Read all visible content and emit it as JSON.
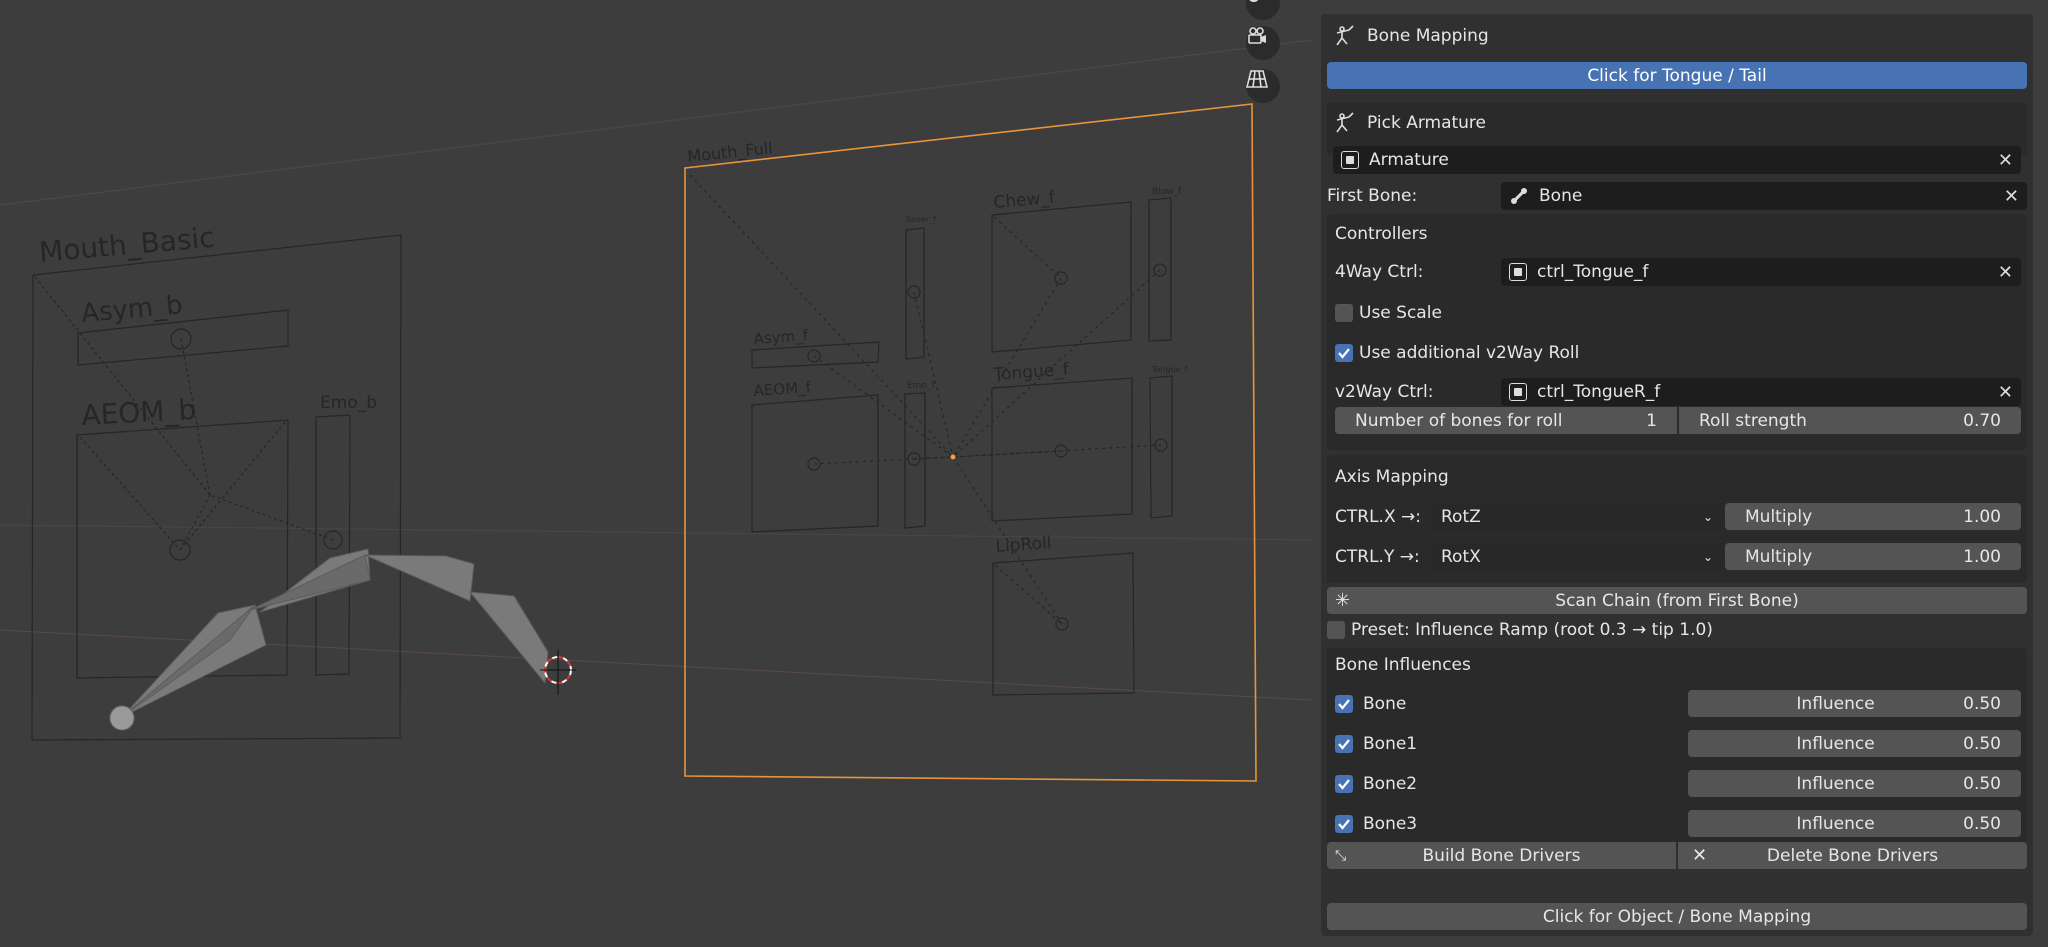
{
  "viewport": {
    "mouth_basic": {
      "title": "Mouth_Basic",
      "labels": [
        "Asym_b",
        "AEOM_b",
        "Emo_b"
      ]
    },
    "mouth_full": {
      "title": "Mouth_Full",
      "labels": [
        "Asym_f",
        "AEOM_f",
        "Sneer_f",
        "Emo_f",
        "Chew_f",
        "Blow_f",
        "Tongue_f",
        "Tongue_f",
        "LipRoll"
      ]
    },
    "tools": [
      "hand-icon",
      "camera-icon",
      "grid-icon"
    ]
  },
  "panel": {
    "header_title": "Bone Mapping",
    "tongue_button": "Click for Tongue / Tail",
    "pick_armature_label": "Pick Armature",
    "armature_value": "Armature",
    "first_bone_label": "First Bone:",
    "first_bone_value": "Bone",
    "controllers_label": "Controllers",
    "fourway_label": "4Way Ctrl:",
    "fourway_value": "ctrl_Tongue_f",
    "use_scale_label": "Use Scale",
    "use_scale_checked": false,
    "use_v2way_label": "Use additional v2Way Roll",
    "use_v2way_checked": true,
    "v2way_label": "v2Way Ctrl:",
    "v2way_value": "ctrl_TongueR_f",
    "num_bones_label": "Number of bones for roll",
    "num_bones_value": "1",
    "roll_strength_label": "Roll strength",
    "roll_strength_value": "0.70",
    "axis_mapping_label": "Axis Mapping",
    "axis_rows": [
      {
        "label": "CTRL.X →:",
        "select": "RotZ",
        "mult_label": "Multiply",
        "mult_value": "1.00"
      },
      {
        "label": "CTRL.Y →:",
        "select": "RotX",
        "mult_label": "Multiply",
        "mult_value": "1.00"
      }
    ],
    "scan_chain_button": "Scan Chain (from First Bone)",
    "preset_label": "Preset: Influence Ramp (root 0.3 → tip 1.0)",
    "bone_influences_label": "Bone Influences",
    "bones": [
      {
        "name": "Bone",
        "checked": true,
        "influence_label": "Influence",
        "influence_value": "0.50"
      },
      {
        "name": "Bone1",
        "checked": true,
        "influence_label": "Influence",
        "influence_value": "0.50"
      },
      {
        "name": "Bone2",
        "checked": true,
        "influence_label": "Influence",
        "influence_value": "0.50"
      },
      {
        "name": "Bone3",
        "checked": true,
        "influence_label": "Influence",
        "influence_value": "0.50"
      }
    ],
    "build_drivers_button": "Build Bone Drivers",
    "delete_drivers_button": "Delete Bone Drivers",
    "object_mapping_button": "Click for Object / Bone Mapping"
  },
  "colors": {
    "accent": "#4772b3",
    "selection": "#f0a040",
    "background": "#3d3d3d"
  }
}
